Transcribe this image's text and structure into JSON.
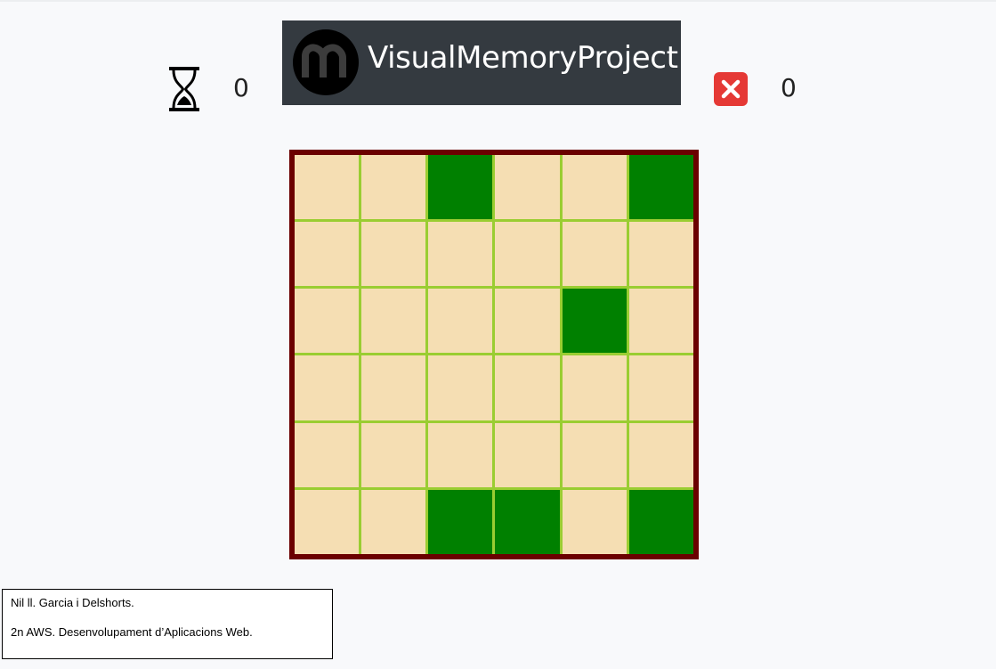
{
  "header": {
    "timer": {
      "icon": "hourglass-icon",
      "value": "0"
    },
    "logo": {
      "badge_icon": "m-logo-icon",
      "text": "VisualMemoryProject",
      "banner_color": "#343a40"
    },
    "errors": {
      "icon": "red-x-icon",
      "icon_color": "#e53935",
      "value": "0"
    }
  },
  "board": {
    "rows": 6,
    "cols": 6,
    "border_color": "#6b0000",
    "grid_line_color": "#9acd32",
    "cell_color": "#f5deb3",
    "lit_color": "#008000",
    "cells": [
      [
        0,
        0,
        1,
        0,
        0,
        1
      ],
      [
        0,
        0,
        0,
        0,
        0,
        0
      ],
      [
        0,
        0,
        0,
        0,
        1,
        0
      ],
      [
        0,
        0,
        0,
        0,
        0,
        0
      ],
      [
        0,
        0,
        0,
        0,
        0,
        0
      ],
      [
        0,
        0,
        1,
        1,
        0,
        1
      ]
    ]
  },
  "footer": {
    "author": "Nil ll. Garcia i Delshorts.",
    "course": "2n AWS. Desenvolupament d’Aplicacions Web."
  }
}
